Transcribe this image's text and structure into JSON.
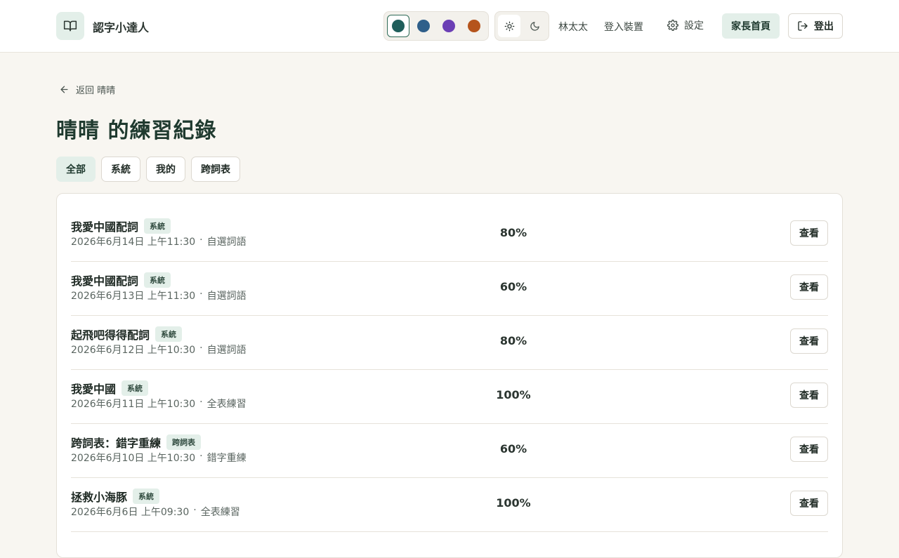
{
  "header": {
    "app_title": "認字小達人",
    "logo_icon": "open-book-icon",
    "color_swatches": [
      {
        "name": "teal",
        "color": "#1f5e5b",
        "selected": true
      },
      {
        "name": "blue",
        "color": "#2f5f8a",
        "selected": false
      },
      {
        "name": "purple",
        "color": "#6b3fb5",
        "selected": false
      },
      {
        "name": "orange",
        "color": "#b5541c",
        "selected": false
      }
    ],
    "theme_modes": [
      {
        "name": "light",
        "icon": "sun-icon",
        "selected": true
      },
      {
        "name": "dark",
        "icon": "moon-icon",
        "selected": false
      }
    ],
    "user_name": "林太太",
    "login_device_label": "登入裝置",
    "settings_label": "設定",
    "parent_home_label": "家長首頁",
    "logout_label": "登出"
  },
  "back_label": "返回 晴晴",
  "page_title": "晴晴 的練習紀錄",
  "filters": [
    {
      "label": "全部",
      "active": true
    },
    {
      "label": "系統",
      "active": false
    },
    {
      "label": "我的",
      "active": false
    },
    {
      "label": "跨詞表",
      "active": false
    }
  ],
  "records": [
    {
      "title": "我愛中國配詞",
      "tag": "系統",
      "date": "2026年6月14日 上午11:30",
      "mode": "自選詞語",
      "score": "80%",
      "view_label": "查看"
    },
    {
      "title": "我愛中國配詞",
      "tag": "系統",
      "date": "2026年6月13日 上午11:30",
      "mode": "自選詞語",
      "score": "60%",
      "view_label": "查看"
    },
    {
      "title": "起飛吧得得配詞",
      "tag": "系統",
      "date": "2026年6月12日 上午10:30",
      "mode": "自選詞語",
      "score": "80%",
      "view_label": "查看"
    },
    {
      "title": "我愛中國",
      "tag": "系統",
      "date": "2026年6月11日 上午10:30",
      "mode": "全表練習",
      "score": "100%",
      "view_label": "查看"
    },
    {
      "title": "跨詞表：錯字重練",
      "tag": "跨詞表",
      "date": "2026年6月10日 上午10:30",
      "mode": "錯字重練",
      "score": "60%",
      "view_label": "查看"
    },
    {
      "title": "拯救小海豚",
      "tag": "系統",
      "date": "2026年6月6日 上午09:30",
      "mode": "全表練習",
      "score": "100%",
      "view_label": "查看"
    }
  ],
  "meta_separator": "·"
}
